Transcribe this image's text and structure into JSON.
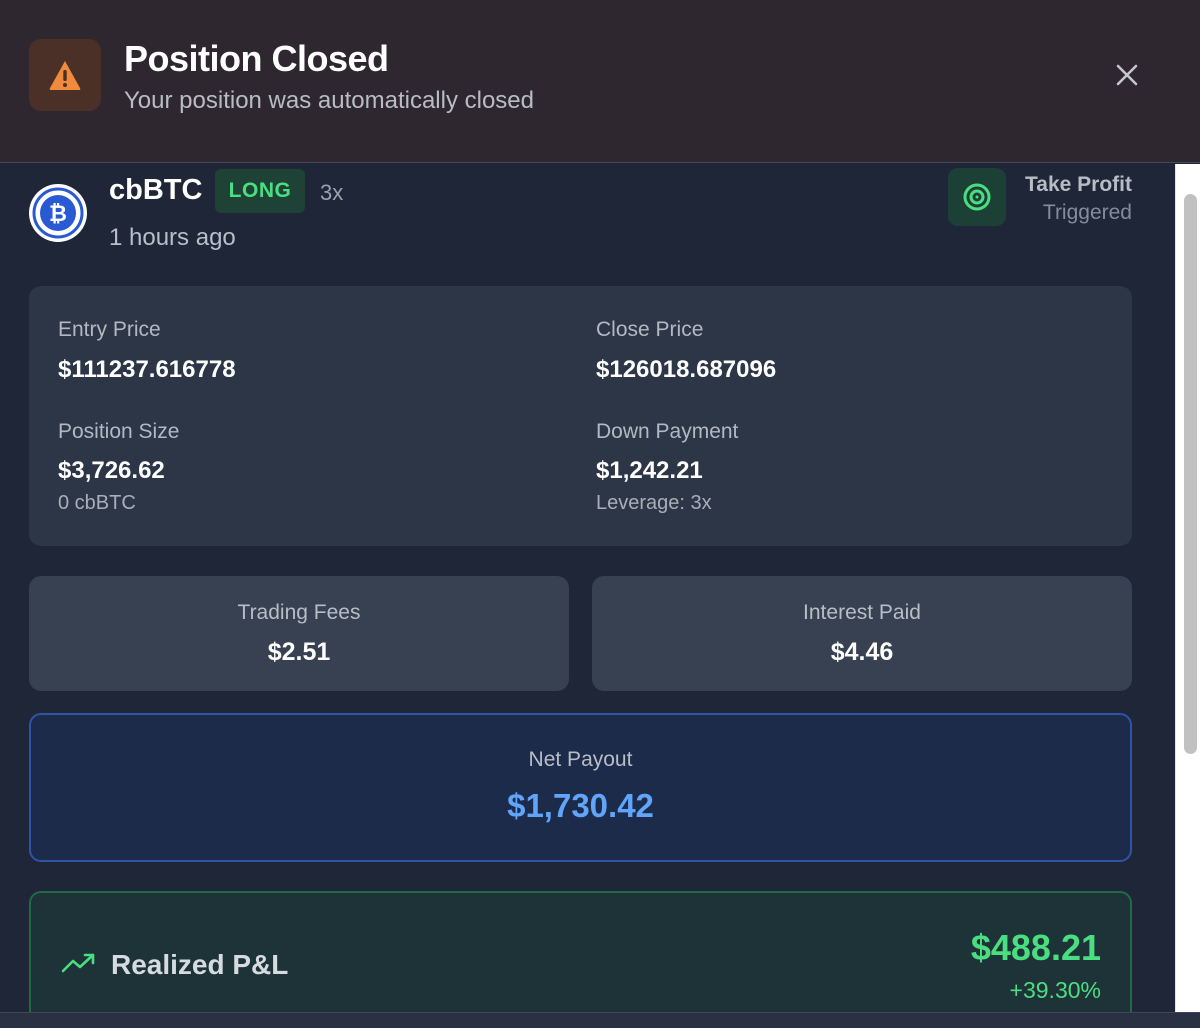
{
  "header": {
    "title": "Position Closed",
    "subtitle": "Your position was automatically closed",
    "icon": "warning-icon",
    "close_icon": "close-icon"
  },
  "position": {
    "asset": "cbBTC",
    "side": "LONG",
    "leverage": "3x",
    "time_ago": "1 hours ago",
    "trigger_title": "Take Profit",
    "trigger_status": "Triggered"
  },
  "details": {
    "entry_price_label": "Entry Price",
    "entry_price": "$111237.616778",
    "close_price_label": "Close Price",
    "close_price": "$126018.687096",
    "position_size_label": "Position Size",
    "position_size": "$3,726.62",
    "position_size_sub": "0 cbBTC",
    "down_payment_label": "Down Payment",
    "down_payment": "$1,242.21",
    "down_payment_sub": "Leverage: 3x"
  },
  "fees": {
    "trading_fees_label": "Trading Fees",
    "trading_fees": "$2.51",
    "interest_paid_label": "Interest Paid",
    "interest_paid": "$4.46"
  },
  "net_payout": {
    "label": "Net Payout",
    "value": "$1,730.42"
  },
  "pnl": {
    "label": "Realized P&L",
    "value": "$488.21",
    "percent": "+39.30%"
  },
  "colors": {
    "accent_green": "#4ade80",
    "accent_blue": "#60a5fa",
    "warning_orange": "#f08a3c",
    "btc_blue": "#2a5ad3"
  }
}
